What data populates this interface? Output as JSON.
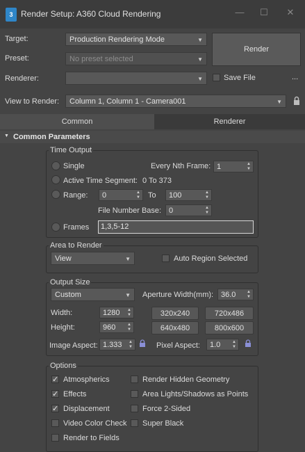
{
  "window": {
    "title": "Render Setup: A360 Cloud Rendering",
    "app_icon_text": "3",
    "minimize_glyph": "—",
    "maximize_glyph": "☐",
    "close_glyph": "✕"
  },
  "header": {
    "target_label": "Target:",
    "target_value": "Production Rendering Mode",
    "preset_label": "Preset:",
    "preset_value": "No preset selected",
    "renderer_label": "Renderer:",
    "renderer_value": "",
    "render_button": "Render",
    "save_file_label": "Save File",
    "save_file_checked": false,
    "ellipsis": "...",
    "view_label": "View to Render:",
    "view_value": "Column 1, Column 1 - Camera001"
  },
  "tabs": [
    {
      "label": "Common",
      "active": true
    },
    {
      "label": "Renderer",
      "active": false
    }
  ],
  "rollout": {
    "title": "Common Parameters",
    "toggle": "▼"
  },
  "time_output": {
    "title": "Time Output",
    "single_label": "Single",
    "every_nth_label": "Every Nth Frame:",
    "every_nth_value": "1",
    "active_segment_label": "Active Time Segment:",
    "active_segment_value": "0 To 373",
    "range_label": "Range:",
    "range_start": "0",
    "range_to": "To",
    "range_end": "100",
    "file_number_base_label": "File Number Base:",
    "file_number_base_value": "0",
    "frames_label": "Frames",
    "frames_value": "1,3,5-12"
  },
  "area_to_render": {
    "title": "Area to Render",
    "mode_value": "View",
    "auto_region_label": "Auto Region Selected",
    "auto_region_checked": false
  },
  "output_size": {
    "title": "Output Size",
    "preset_value": "Custom",
    "aperture_label": "Aperture Width(mm):",
    "aperture_value": "36.0",
    "width_label": "Width:",
    "width_value": "1280",
    "height_label": "Height:",
    "height_value": "960",
    "preset_buttons": [
      "320x240",
      "720x486",
      "640x480",
      "800x600"
    ],
    "image_aspect_label": "Image Aspect:",
    "image_aspect_value": "1.333",
    "pixel_aspect_label": "Pixel Aspect:",
    "pixel_aspect_value": "1.0"
  },
  "options": {
    "title": "Options",
    "items": [
      {
        "label": "Atmospherics",
        "checked": true
      },
      {
        "label": "Render Hidden Geometry",
        "checked": false
      },
      {
        "label": "Effects",
        "checked": true
      },
      {
        "label": "Area Lights/Shadows as Points",
        "checked": false
      },
      {
        "label": "Displacement",
        "checked": true
      },
      {
        "label": "Force 2-Sided",
        "checked": false
      },
      {
        "label": "Video Color Check",
        "checked": false
      },
      {
        "label": "Super Black",
        "checked": false
      },
      {
        "label": "Render to Fields",
        "checked": false
      }
    ],
    "check_glyph": "✓"
  },
  "colors": {
    "background": "#444444",
    "titlebar": "#3c3c3c",
    "app_icon": "#2f86c8",
    "lock_icon": "#8a8fd6"
  }
}
